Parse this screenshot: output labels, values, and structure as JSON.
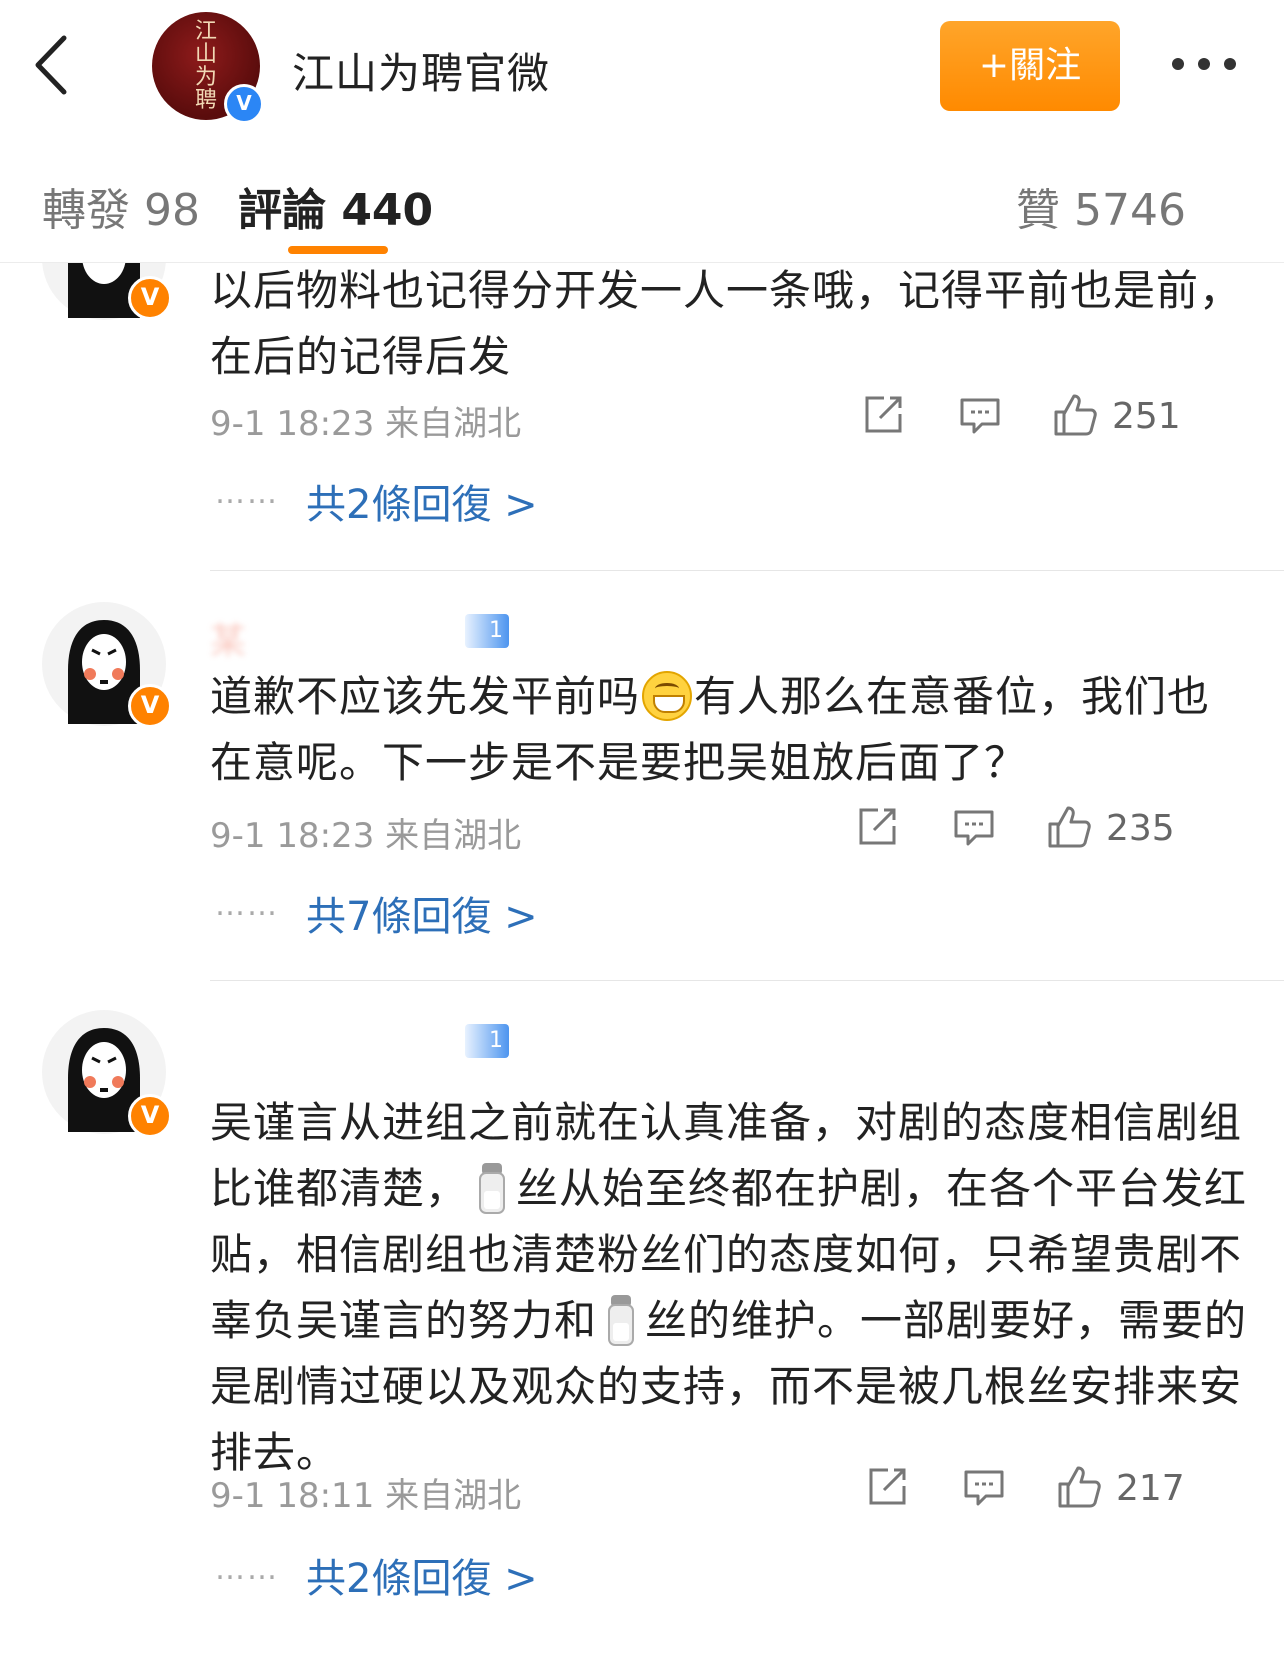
{
  "header": {
    "title": "江山为聘官微",
    "avatar_text": "江山为聘",
    "verified_mark": "V",
    "follow_label": "+關注"
  },
  "tabs": [
    {
      "label": "轉發 98",
      "active": false
    },
    {
      "label": "評論 440",
      "active": true
    },
    {
      "label": "贊 5746",
      "active": false
    }
  ],
  "comments": [
    {
      "badge": "V",
      "text": "以后物料也记得分开发一人一条哦，记得平前也是前，在后的记得后发",
      "meta": "9-1 18:23  来自湖北",
      "likes": "251",
      "replies": "共2條回復 >"
    },
    {
      "badge": "V",
      "name": "某",
      "fan_level": "1",
      "text_before_emoji": "道歉不应该先发平前吗",
      "emoji": "grin-emoji",
      "text_after_emoji": "有人那么在意番位，我们也在意呢。下一步是不是要把吴姐放后面了？",
      "meta": "9-1 18:23  来自湖北",
      "likes": "235",
      "replies": "共7條回復 >"
    },
    {
      "badge": "V",
      "fan_level": "1",
      "text_part1": "吴谨言从进组之前就在认真准备，对剧的态度相信剧组比谁都清楚，",
      "text_part2": "丝从始至终都在护剧，在各个平台发红贴，相信剧组也清楚粉丝们的态度如何，只希望贵剧不辜负吴谨言的努力和",
      "text_part3": "丝的维护。一部剧要好，需要的是剧情过硬以及观众的支持，而不是被几根丝安排来安排去。",
      "meta": "9-1 18:11  来自湖北",
      "likes": "217",
      "replies": "共2條回復 >"
    }
  ],
  "ui": {
    "dots": "……",
    "accent": "#ff8200",
    "link_color": "#2d6fb8",
    "verified_color": "#2b86f5"
  }
}
